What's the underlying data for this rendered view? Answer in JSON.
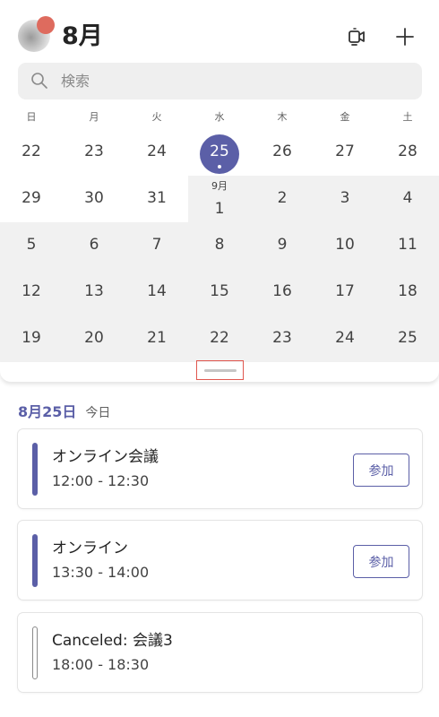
{
  "header": {
    "month_title": "8月",
    "meet_icon": "video-meet-icon",
    "add_icon": "plus-icon"
  },
  "search": {
    "placeholder": "検索",
    "value": ""
  },
  "calendar": {
    "weekdays": [
      "日",
      "月",
      "火",
      "水",
      "木",
      "金",
      "土"
    ],
    "rows": [
      [
        "22",
        "23",
        "24",
        "25",
        "26",
        "27",
        "28"
      ],
      [
        "29",
        "30",
        "31",
        "1",
        "2",
        "3",
        "4"
      ],
      [
        "5",
        "6",
        "7",
        "8",
        "9",
        "10",
        "11"
      ],
      [
        "12",
        "13",
        "14",
        "15",
        "16",
        "17",
        "18"
      ],
      [
        "19",
        "20",
        "21",
        "22",
        "23",
        "24",
        "25"
      ]
    ],
    "next_month_label": "9月",
    "selected_day": "25",
    "accent_color": "#5b5fa7"
  },
  "agenda": {
    "date": "8月25日",
    "relative": "今日",
    "events": [
      {
        "title": "オンライン会議",
        "time": "12:00 - 12:30",
        "action": "参加"
      },
      {
        "title": "オンライン",
        "time": "13:30 - 14:00",
        "action": "参加"
      },
      {
        "title": "Canceled: 会議3",
        "time": "18:00 - 18:30"
      }
    ]
  }
}
